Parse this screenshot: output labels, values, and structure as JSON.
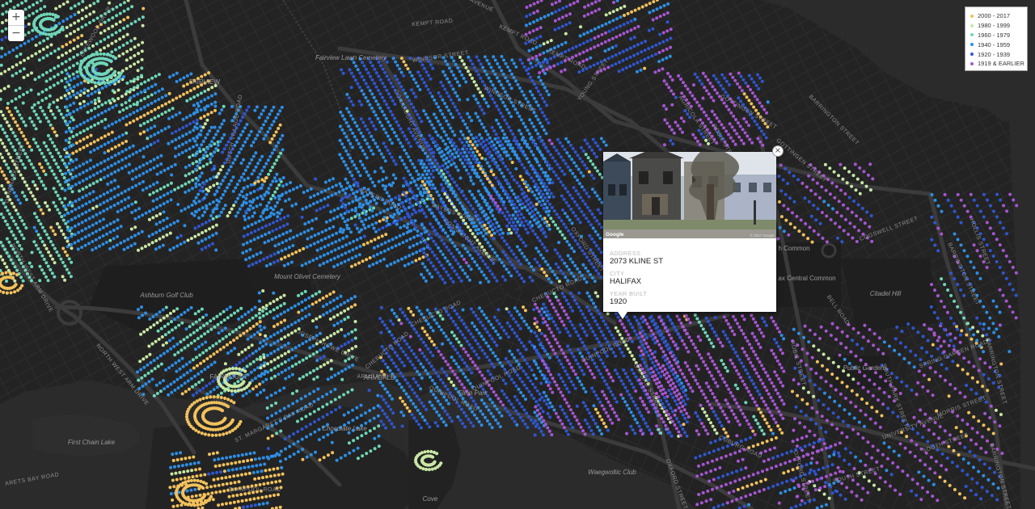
{
  "map": {
    "controls": {
      "zoom_in": "+",
      "zoom_out": "−"
    },
    "colors": {
      "background": "#1b1b1b",
      "block": "#232323",
      "road": "#343434",
      "major_road": "#3c3c3c",
      "water": "#2b2b2b",
      "park": "#1f1f1f",
      "road_label": "#8d8d8d",
      "place_label": "#7a7a7a"
    },
    "street_labels": [
      "LAKEWOOD DRIVE",
      "KEMPT ROAD",
      "KEMPT ROAD",
      "AVENUE",
      "KEMPT ROAD",
      "WINDSOR STREET",
      "YOUNG STREET",
      "WINDSOR STREET",
      "CONNAUGHT AVENUE",
      "GOTTINGEN STREET",
      "AGRICOLA STREET",
      "ROBIE STREET",
      "BARRINGTON STREET",
      "GOTTINGEN STREET",
      "DUTCH VILLAGE ROAD",
      "BAYERS ROAD",
      "BAYERS ROAD",
      "DUNBRACK STREET",
      "NORTH WEST ARM DRIVE",
      "CONNAUGHT AVENUE",
      "OXFORD STREET",
      "CHEBUCTO ROAD",
      "COGSWELL STREET",
      "HOLLIS STREET",
      "BARRINGTON STREET",
      "BELL ROAD",
      "CHEBUCTO ROAD",
      "CHEBUCTO ROAD",
      "JOSEPH HOWE DRIVE",
      "QUINPOOL ROAD",
      "QUINPOOL ROAD",
      "OXFORD STREET",
      "ROBIE STREET",
      "SOUTH PARK STREET",
      "SPRING GARDEN ROAD",
      "BARRINGTON STREET",
      "NORTH WEST ARM DRIVE",
      "QUINPOOL ROAD",
      "ST. MARGARET'S BAY ROAD",
      "MORRIS STREET",
      "UNIVERSITY AVENUE",
      "SOUTH STREET",
      "COBURG ROAD",
      "SOUTH STREET",
      "OXFORD STREET",
      "ARETS BAY ROAD",
      "ARMDALE",
      "QUINPOOL ROAD",
      "OXFORD STREET",
      "BARRINGTON STREET"
    ],
    "place_labels": [
      "Fairview Lawn Cemetery",
      "FAIRVIEW",
      "Mount Olivet Cemetery",
      "Ashburn Golf Club",
      "FAIRMOUNT",
      "ARMDALE",
      "Flinn Park",
      "Chocolate Lake",
      "First Chain Lake",
      "Waegwoltic Club",
      "Citadel Hill",
      "Public Gardens",
      "h Common",
      "ax Central Common",
      "Cove"
    ],
    "legend": [
      {
        "label": "2000 - 2017",
        "color": "#f1c15c"
      },
      {
        "label": "1980 - 1999",
        "color": "#c9e7a5"
      },
      {
        "label": "1960 - 1979",
        "color": "#6fd6b8"
      },
      {
        "label": "1940 - 1959",
        "color": "#2e8ee4"
      },
      {
        "label": "1920 - 1939",
        "color": "#2f56cf"
      },
      {
        "label": "1919 & EARLIER",
        "color": "#a556d2"
      }
    ],
    "popup": {
      "close": "×",
      "image_credit": "Google",
      "image_copyright": "© 2017 Google",
      "fields": [
        {
          "label": "ADDRESS",
          "value": "2073 KLINE ST"
        },
        {
          "label": "CITY",
          "value": "HALIFAX"
        },
        {
          "label": "YEAR BUILT",
          "value": "1920"
        }
      ]
    }
  }
}
